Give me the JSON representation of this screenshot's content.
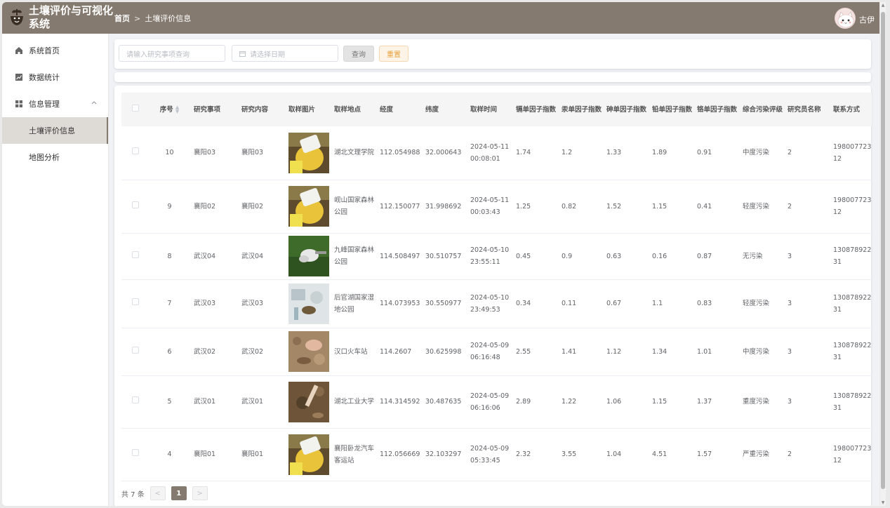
{
  "app": {
    "title": "土壤评价与可视化系统",
    "user": "古伊"
  },
  "breadcrumb": {
    "home": "首页",
    "sep": ">",
    "current": "土壤评价信息"
  },
  "sidebar": {
    "items": [
      {
        "label": "系统首页",
        "icon": "home-icon"
      },
      {
        "label": "数据统计",
        "icon": "chart-icon"
      },
      {
        "label": "信息管理",
        "icon": "grid-icon"
      }
    ],
    "sub": [
      {
        "label": "土壤评价信息",
        "active": true
      },
      {
        "label": "地图分析",
        "active": false
      }
    ]
  },
  "search": {
    "keyword_placeholder": "请输入研究事项查询",
    "date_placeholder": "请选择日期",
    "query_label": "查询",
    "reset_label": "重置"
  },
  "table": {
    "headers": [
      "序号",
      "研究事项",
      "研究内容",
      "取样图片",
      "取样地点",
      "经度",
      "纬度",
      "取样时间",
      "镉单因子指数",
      "汞单因子指数",
      "砷单因子指数",
      "铅单因子指数",
      "铬单因子指数",
      "综合污染评级",
      "研究员名称",
      "联系方式"
    ],
    "rows": [
      {
        "id": "10",
        "item": "襄阳03",
        "content": "襄阳03",
        "place": "湖北文理学院",
        "lng": "112.054988",
        "lat": "32.000643",
        "time": "2024-05-11 00:08:01",
        "cd": "1.74",
        "hg": "1.2",
        "as": "1.33",
        "pb": "1.89",
        "cr": "0.91",
        "level": "中度污染",
        "researcher": "2",
        "phone": "19800772312",
        "img": "glove"
      },
      {
        "id": "9",
        "item": "襄阳02",
        "content": "襄阳02",
        "place": "岘山国家森林公园",
        "lng": "112.150077",
        "lat": "31.998692",
        "time": "2024-05-11 00:03:43",
        "cd": "1.25",
        "hg": "0.82",
        "as": "1.52",
        "pb": "1.15",
        "cr": "0.41",
        "level": "轻度污染",
        "researcher": "2",
        "phone": "19800772312",
        "img": "glove"
      },
      {
        "id": "8",
        "item": "武汉04",
        "content": "武汉04",
        "place": "九峰国家森林公园",
        "lng": "114.508497",
        "lat": "30.510757",
        "time": "2024-05-10 23:55:11",
        "cd": "0.45",
        "hg": "0.9",
        "as": "0.63",
        "pb": "0.16",
        "cr": "0.87",
        "level": "无污染",
        "researcher": "3",
        "phone": "13087892231",
        "img": "grass"
      },
      {
        "id": "7",
        "item": "武汉03",
        "content": "武汉03",
        "place": "后官湖国家湿地公园",
        "lng": "114.073953",
        "lat": "30.550977",
        "time": "2024-05-10 23:49:53",
        "cd": "0.34",
        "hg": "0.11",
        "as": "0.67",
        "pb": "1.1",
        "cr": "0.83",
        "level": "轻度污染",
        "researcher": "3",
        "phone": "13087892231",
        "img": "lab"
      },
      {
        "id": "6",
        "item": "武汉02",
        "content": "武汉02",
        "place": "汉口火车站",
        "lng": "114.2607",
        "lat": "30.625998",
        "time": "2024-05-09 06:16:48",
        "cd": "2.55",
        "hg": "1.41",
        "as": "1.12",
        "pb": "1.34",
        "cr": "1.01",
        "level": "中度污染",
        "researcher": "3",
        "phone": "13087892231",
        "img": "soil"
      },
      {
        "id": "5",
        "item": "武汉01",
        "content": "武汉01",
        "place": "湖北工业大学",
        "lng": "114.314592",
        "lat": "30.487635",
        "time": "2024-05-09 06:16:06",
        "cd": "2.89",
        "hg": "1.22",
        "as": "1.06",
        "pb": "1.15",
        "cr": "1.37",
        "level": "重度污染",
        "researcher": "3",
        "phone": "13087892231",
        "img": "dig"
      },
      {
        "id": "4",
        "item": "襄阳01",
        "content": "襄阳01",
        "place": "襄阳卧龙汽车客运站",
        "lng": "112.056669",
        "lat": "32.103297",
        "time": "2024-05-09 05:33:45",
        "cd": "2.32",
        "hg": "3.55",
        "as": "1.04",
        "pb": "4.51",
        "cr": "1.57",
        "level": "严重污染",
        "researcher": "2",
        "phone": "19800772312",
        "img": "glove"
      }
    ]
  },
  "pager": {
    "total": "共 7 条",
    "current": "1",
    "prev": "<",
    "next": ">"
  }
}
